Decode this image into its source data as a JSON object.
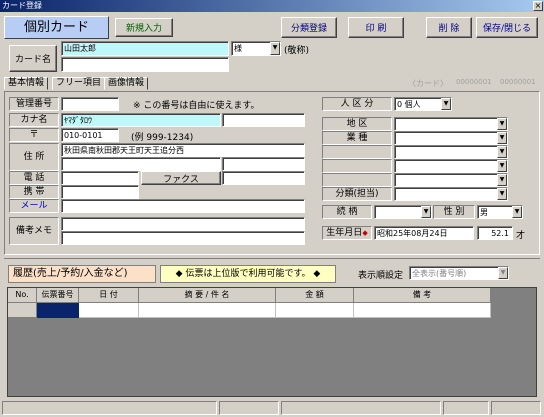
{
  "window": {
    "title": "カード登録",
    "close_glyph": "×"
  },
  "toolbar": {
    "card_badge": "個別カード",
    "new_entry": "新規入力",
    "register_category": "分類登録",
    "print": "印 刷",
    "delete": "削 除",
    "save_close": "保存/閉じる"
  },
  "card_name": {
    "label": "カード名",
    "value": "山田太郎",
    "honorific": "様",
    "honorific_note": "(敬称)"
  },
  "tabs": [
    "基本情報",
    "フリー項目",
    "画像情報"
  ],
  "card_counter": "〈カード〉",
  "card_number": "00000001",
  "card_total": "00000001",
  "basic": {
    "mgmt_label": "管理番号",
    "mgmt_value": "",
    "mgmt_note": "※ この番号は自由に使えます。",
    "kana_label": "カナ名",
    "kana_value": "ﾔﾏﾀﾞﾀﾛｳ",
    "zip_label": "〒",
    "zip_value": "010-0101",
    "zip_example": "(例 999-1234)",
    "address_label": "住 所",
    "address_value": "秋田県南秋田郡天王町天王追分西",
    "phone_label": "電 話",
    "fax_label": "ファクス",
    "mobile_label": "携 帯",
    "email_label": "メール",
    "memo_label": "備考メモ"
  },
  "right": {
    "person_type_label": "人 区 分",
    "person_type_value": "0 個人",
    "region_label": "地 区",
    "industry_label": "業 種",
    "category_label": "分類(担当)",
    "title_label": "続 柄",
    "gender_label": "性 別",
    "gender_value": "男",
    "birthday_label": "生年月日",
    "birthday_marker": "◆",
    "birthday_value": "昭和25年08月24日",
    "age_value": "52.1",
    "age_unit": "才"
  },
  "history": {
    "label": "履歴(売上/予約/入金など)",
    "notice": "◆ 伝票は上位版で利用可能です。 ◆",
    "order_label": "表示順設定",
    "order_value": "全表示(番号順)",
    "columns": [
      "No.",
      "伝票番号",
      "日 付",
      "摘 要 / 件 名",
      "金 額",
      "備 考"
    ]
  },
  "colors": {
    "title_bar": "#0a246a",
    "card_badge": "#b7cdf4",
    "kana_field": "#bff8f8",
    "history_label_bg": "#fde0c8",
    "notice_bg": "#ffffc0"
  }
}
